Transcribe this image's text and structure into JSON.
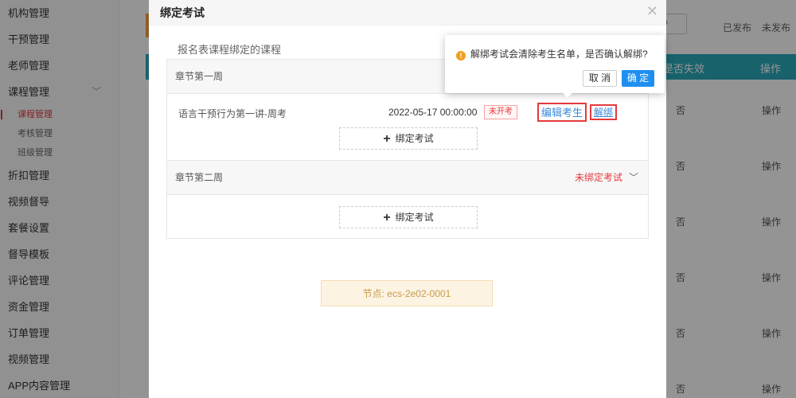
{
  "sidebar": {
    "items": [
      {
        "label": "机构管理"
      },
      {
        "label": "干预管理"
      },
      {
        "label": "老师管理"
      },
      {
        "label": "课程管理"
      }
    ],
    "sub_items": [
      {
        "label": "课程管理"
      },
      {
        "label": "考核管理"
      },
      {
        "label": "班级管理"
      }
    ],
    "items_after": [
      {
        "label": "折扣管理"
      },
      {
        "label": "视频督导"
      },
      {
        "label": "套餐设置"
      },
      {
        "label": "督导模板"
      },
      {
        "label": "评论管理"
      },
      {
        "label": "资金管理"
      },
      {
        "label": "订单管理"
      },
      {
        "label": "视频管理"
      },
      {
        "label": "APP内容管理"
      }
    ]
  },
  "background": {
    "filters": [
      "已发布",
      "未发布"
    ],
    "headers": [
      "是否失效",
      "操作"
    ],
    "rows": [
      {
        "expired": "否",
        "action": "操作"
      },
      {
        "expired": "否",
        "action": "操作"
      },
      {
        "expired": "否",
        "action": "操作"
      },
      {
        "expired": "否",
        "action": "操作"
      },
      {
        "expired": "否",
        "action": "操作"
      },
      {
        "expired": "否",
        "action": "操作"
      }
    ]
  },
  "modal": {
    "title": "绑定考试",
    "section_title": "报名表课程绑定的课程",
    "chapters": [
      {
        "name": "章节第一周",
        "lesson": {
          "name": "语言干预行为第一讲-周考",
          "time": "2022-05-17 00:00:00",
          "status": "未开考",
          "edit_label": "编辑考生",
          "unbind_label": "解绑"
        },
        "bind_label": "绑定考试"
      },
      {
        "name": "章节第二周",
        "status": "未绑定考试",
        "bind_label": "绑定考试"
      }
    ],
    "node": "节点: ecs-2e02-0001"
  },
  "popconfirm": {
    "message": "解绑考试会清除考生名单，是否确认解绑?",
    "cancel_label": "取 消",
    "ok_label": "确 定"
  },
  "colors": {
    "accent": "#1e8ff0",
    "danger": "#e4393c",
    "table_header": "#2aa9ba",
    "warning": "#f0a020"
  }
}
